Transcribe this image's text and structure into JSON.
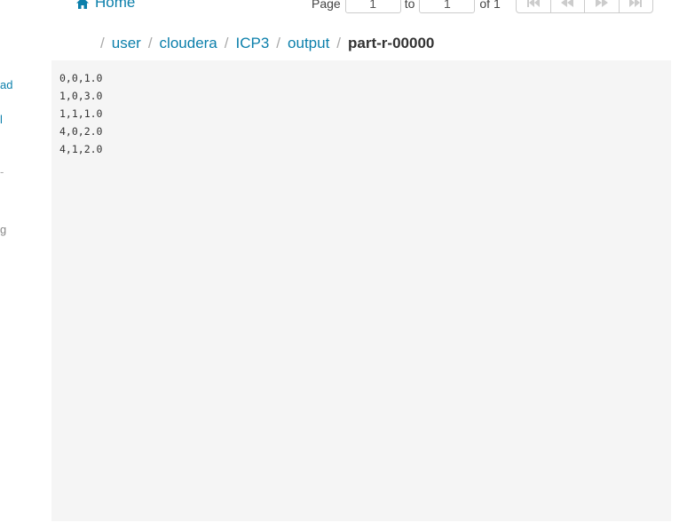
{
  "header": {
    "home_label": "Home"
  },
  "pager": {
    "page_label": "Page",
    "from_value": "1",
    "to_label": "to",
    "to_value": "1",
    "of_label": "of 1"
  },
  "sidebar_fragments": [
    {
      "text": "ad",
      "color": "#0b7fab"
    },
    {
      "text": "l",
      "color": "#0b7fab"
    },
    {
      "text": "-",
      "color": "#aaaaaa"
    },
    {
      "text": "g",
      "color": "#888888"
    }
  ],
  "breadcrumb": {
    "separator": "/",
    "links": [
      "user",
      "cloudera",
      "ICP3",
      "output"
    ],
    "current": "part-r-00000"
  },
  "file_content": {
    "lines": [
      "0,0,1.0",
      "1,0,3.0",
      "1,1,1.0",
      "4,0,2.0",
      "4,1,2.0"
    ]
  },
  "colors": {
    "link": "#0b7fab",
    "text": "#333333",
    "content_bg": "#f5f5f5",
    "button_icon": "#cccccc"
  }
}
